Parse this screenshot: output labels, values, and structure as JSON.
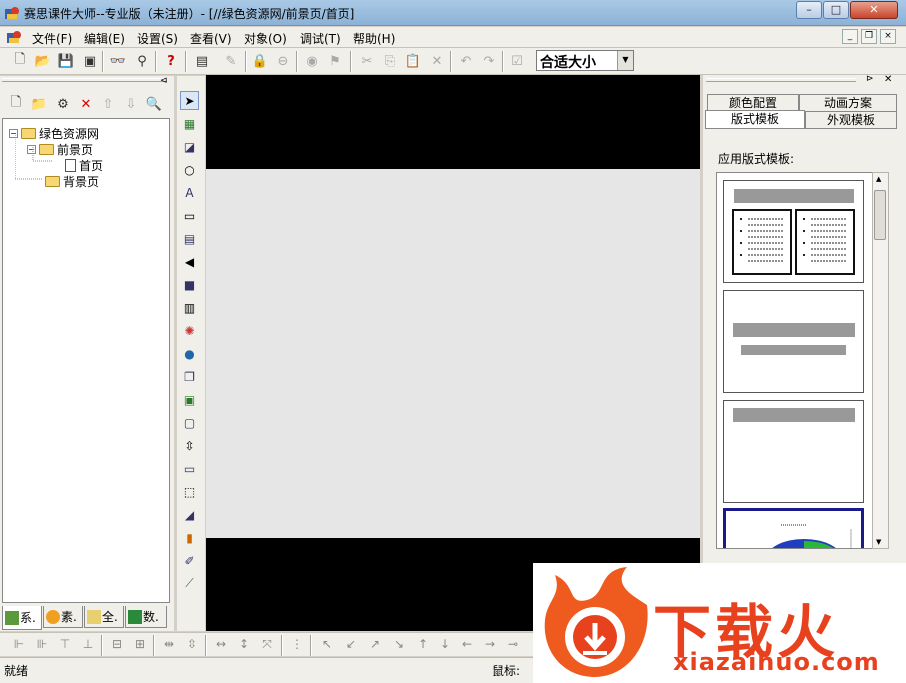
{
  "window": {
    "title": "赛思课件大师--专业版（未注册）- [//绿色资源网/前景页/首页]",
    "min_label": "–",
    "max_label": "□",
    "close_label": "✕"
  },
  "menu": [
    "文件(F)",
    "编辑(E)",
    "设置(S)",
    "查看(V)",
    "对象(O)",
    "调试(T)",
    "帮助(H)"
  ],
  "toolbar": {
    "zoom_value": "合适大小"
  },
  "tree": {
    "root": "绿色资源网",
    "foreground": "前景页",
    "home": "首页",
    "background": "背景页"
  },
  "left_tabs": [
    "系.",
    "素.",
    "全.",
    "数."
  ],
  "right_panel": {
    "tabs_back": [
      "颜色配置",
      "动画方案"
    ],
    "tabs_front": [
      "版式模板",
      "外观模板"
    ],
    "label": "应用版式模板:"
  },
  "status": {
    "text": "就绪",
    "mouse_label": "鼠标:"
  },
  "watermark": {
    "text": "下载火",
    "url": "xiazaihuo.com"
  },
  "colors": {
    "canvas": "#000000",
    "stage": "#e6e6e6",
    "watermark": "#e8411e"
  }
}
